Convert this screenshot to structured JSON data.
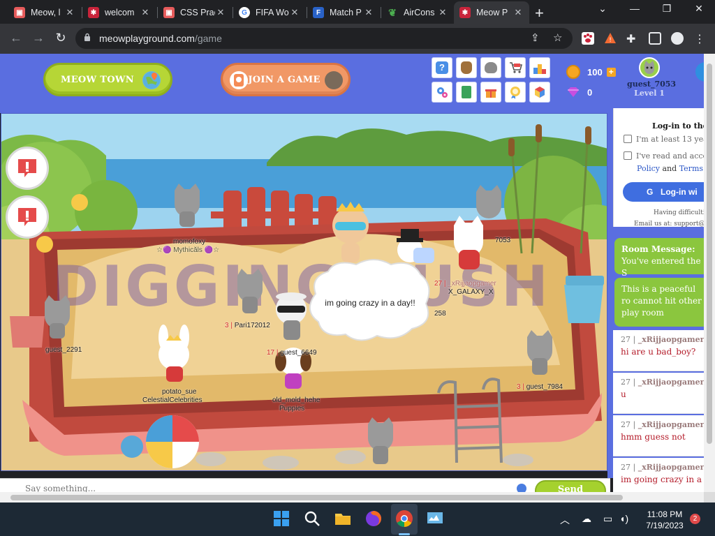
{
  "browser": {
    "tabs": [
      {
        "title": "Meow, l",
        "favicon_color": "#e65b5b"
      },
      {
        "title": "welcom",
        "favicon_color": "#c9243b"
      },
      {
        "title": "CSS Prac",
        "favicon_color": "#e65b5b"
      },
      {
        "title": "FIFA Wo",
        "favicon_color": "#4285f4"
      },
      {
        "title": "Match P",
        "favicon_color": "#2962c8"
      },
      {
        "title": "AirCons",
        "favicon_color": "#4caf50"
      },
      {
        "title": "Meow P",
        "favicon_color": "#c9243b"
      }
    ],
    "new_tab_icon": "+",
    "address": {
      "host": "meowplayground.com",
      "path": "/game"
    }
  },
  "header": {
    "meow_town_label": "MEOW TOWN",
    "join_game_label": "JOIN A GAME",
    "coins": "100",
    "gems": "0",
    "username": "guest_7053",
    "level": "Level 1",
    "grid_icons": [
      "help-icon",
      "bag-icon",
      "cat-icon",
      "cart-icon",
      "podium-icon",
      "settings-icon",
      "list-icon",
      "gift-icon",
      "trophy-icon",
      "cube-icon"
    ]
  },
  "scene": {
    "sign_text": "DIGGING PUSH",
    "speech_bubble": "im going crazy in a  day!!",
    "players": [
      {
        "name": "momofoxy",
        "sub": "☆🟣 Mythicăls 🟣☆"
      },
      {
        "level": "3 |",
        "name": "Pari172012"
      },
      {
        "name": "guest_2291"
      },
      {
        "name": "potato_sue",
        "sub": "CelestialCelebrities"
      },
      {
        "level": "17 |",
        "name": "guest_6649"
      },
      {
        "name": "old_mold_hehe",
        "sub": "Puppies"
      },
      {
        "level": "27 |",
        "name": "_xRijjaopgamer",
        "sub": "X_GALAXY_X"
      },
      {
        "name": "7053"
      },
      {
        "level": "3 |",
        "name": "guest_7984"
      },
      {
        "name": "258"
      }
    ]
  },
  "chat_input": {
    "placeholder": "Say something...",
    "send_label": "Send"
  },
  "login_panel": {
    "title": "Log-in to the p",
    "age_check": "I'm at least 13 years",
    "terms_check": "I've read and accept",
    "links_policy": "Policy",
    "links_and": " and ",
    "links_terms": "Terms O",
    "google_btn": "Log-in wi",
    "help": "Having difficultie",
    "email": "Email us at: support@m"
  },
  "room_messages": [
    {
      "title": "Room Message:",
      "body": "You've entered the S"
    },
    {
      "body": "This is a peaceful ro cannot hit other play room"
    }
  ],
  "chat_messages": [
    {
      "level": "27 |",
      "user": "_xRijjaopgamer",
      "text": "hi are u bad_boy?"
    },
    {
      "level": "27 |",
      "user": "_xRijjaopgamer",
      "text": "u"
    },
    {
      "level": "27 |",
      "user": "_xRijjaopgamer",
      "text": "hmm guess not"
    },
    {
      "level": "27 |",
      "user": "_xRijjaopgamer",
      "text": "im going crazy in a d"
    }
  ],
  "taskbar": {
    "time": "11:08 PM",
    "date": "7/19/2023",
    "notifications": "2"
  }
}
